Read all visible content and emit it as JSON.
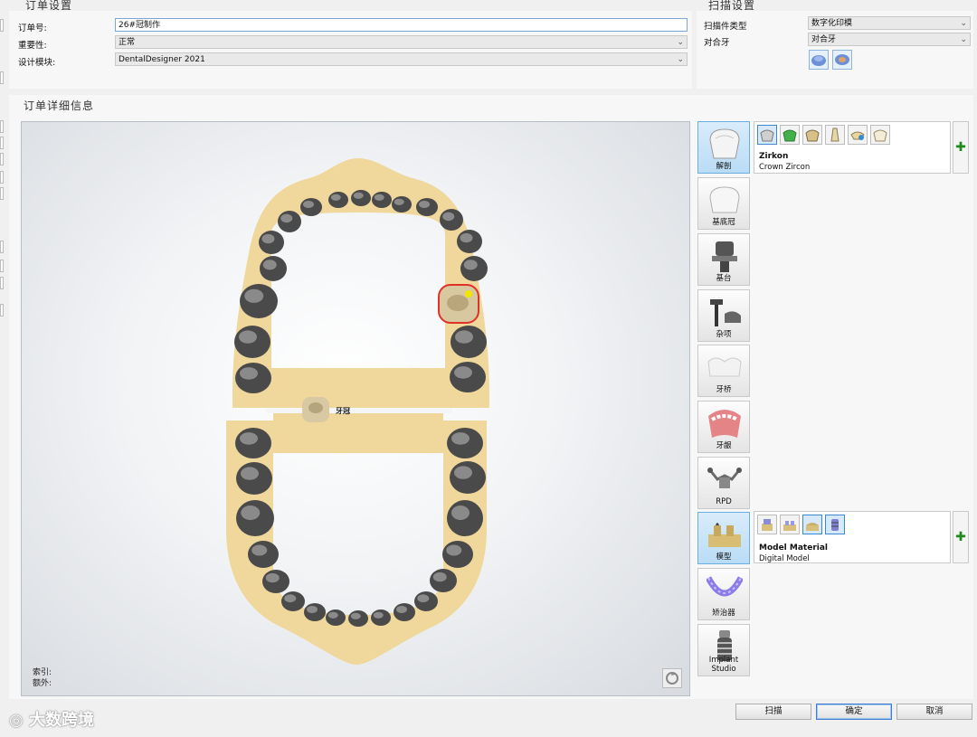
{
  "order_settings": {
    "title": "订单设置",
    "order_no_label": "订单号:",
    "order_no_value": "26#冠制作",
    "importance_label": "重要性:",
    "importance_value": "正常",
    "design_module_label": "设计模块:",
    "design_module_value": "DentalDesigner 2021"
  },
  "scan_settings": {
    "title": "扫描设置",
    "scan_type_label": "扫描件类型",
    "scan_type_value": "数字化印模",
    "antagonist_label": "对合牙",
    "antagonist_value": "对合牙"
  },
  "order_details": {
    "title": "订单详细信息",
    "crown_label": "牙冠",
    "index_label": "索引:",
    "extra_label": "额外:"
  },
  "categories": [
    {
      "label": "解剖",
      "icon": "anatomy-crown-icon",
      "selected": true
    },
    {
      "label": "基底冠",
      "icon": "coping-icon",
      "selected": false
    },
    {
      "label": "基台",
      "icon": "abutment-icon",
      "selected": false
    },
    {
      "label": "杂项",
      "icon": "misc-icon",
      "selected": false
    },
    {
      "label": "牙桥",
      "icon": "bridge-icon",
      "selected": false
    },
    {
      "label": "牙龈",
      "icon": "gingiva-icon",
      "selected": false
    },
    {
      "label": "RPD",
      "icon": "rpd-icon",
      "selected": false
    },
    {
      "label": "模型",
      "icon": "model-icon",
      "selected": true
    },
    {
      "label": "矫治器",
      "icon": "aligner-icon",
      "selected": false
    },
    {
      "label": "Implant Studio",
      "icon": "implant-icon",
      "selected": false
    }
  ],
  "anatomy_detail": {
    "material": "Zirkon",
    "description": "Crown Zircon"
  },
  "model_detail": {
    "material": "Model Material",
    "description": "Digital Model"
  },
  "buttons": {
    "scan": "扫描",
    "ok": "确定",
    "cancel": "取消"
  },
  "watermark": "大数跨境",
  "colors": {
    "accent": "#3b88d0",
    "jaw": "#f0d79c",
    "selected_tooth": "#e0322b",
    "plus": "#1d8a1d"
  }
}
